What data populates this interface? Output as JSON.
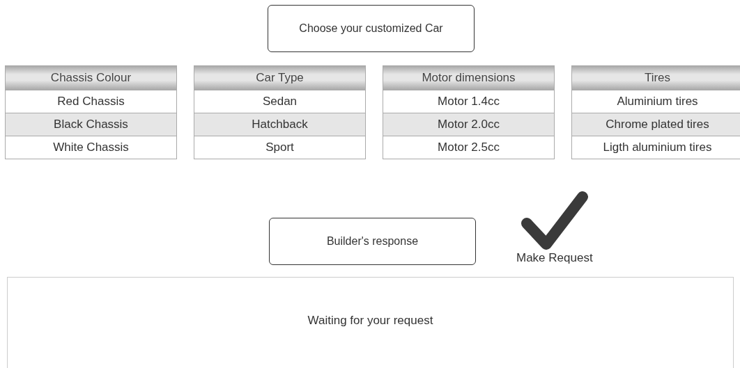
{
  "title": "Choose your customized Car",
  "option_tables": [
    {
      "header": "Chassis Colour",
      "options": [
        "Red Chassis",
        "Black Chassis",
        "White Chassis"
      ]
    },
    {
      "header": "Car Type",
      "options": [
        "Sedan",
        "Hatchback",
        "Sport"
      ]
    },
    {
      "header": "Motor dimensions",
      "options": [
        "Motor 1.4cc",
        "Motor 2.0cc",
        "Motor 2.5cc"
      ]
    },
    {
      "header": "Tires",
      "options": [
        "Aluminium tires",
        "Chrome plated tires",
        "Ligth aluminium tires"
      ]
    }
  ],
  "response_label": "Builder's response",
  "make_request_button": {
    "label": "Make Request"
  },
  "response_panel": {
    "text": "Waiting for your request"
  }
}
